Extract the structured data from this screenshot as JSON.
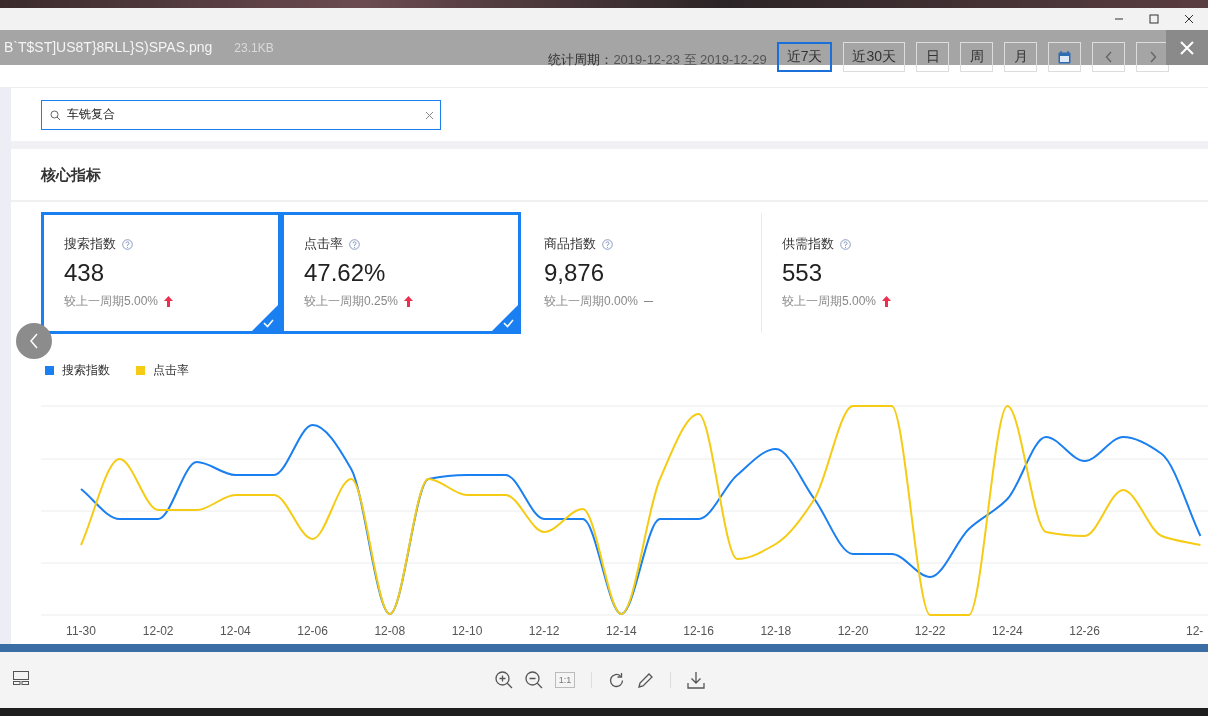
{
  "viewer": {
    "file_name": "B`T$ST]US8T}8RLL}S)SPAS.png",
    "file_size": "23.1KB"
  },
  "period": {
    "label": "统计周期：",
    "range": "2019-12-23 至 2019-12-29"
  },
  "range_buttons": [
    {
      "kind": "text",
      "label": "近7天",
      "selected": true
    },
    {
      "kind": "text",
      "label": "近30天",
      "selected": false
    },
    {
      "kind": "text",
      "label": "日",
      "selected": false
    },
    {
      "kind": "text",
      "label": "周",
      "selected": false
    },
    {
      "kind": "text",
      "label": "月",
      "selected": false
    },
    {
      "kind": "calendar",
      "selected": false
    },
    {
      "kind": "prev",
      "selected": false
    },
    {
      "kind": "next",
      "selected": false
    }
  ],
  "search": {
    "value": "车铣复合"
  },
  "section": {
    "title": "核心指标"
  },
  "metrics": [
    {
      "label": "搜索指数",
      "value": "438",
      "change": "较上一周期5.00%",
      "kind": "up",
      "selected": true
    },
    {
      "label": "点击率",
      "value": "47.62%",
      "change": "较上一周期0.25%",
      "kind": "up",
      "selected": true
    },
    {
      "label": "商品指数",
      "value": "9,876",
      "change": "较上一周期0.00%",
      "kind": "flat",
      "selected": false
    },
    {
      "label": "供需指数",
      "value": "553",
      "change": "较上一周期5.00%",
      "kind": "up",
      "selected": false
    }
  ],
  "chart": {
    "legend": [
      {
        "name": "搜索指数",
        "color": "#1a7ff0"
      },
      {
        "name": "点击率",
        "color": "#f5cb14"
      }
    ],
    "x_labels": [
      "11-30",
      "12-02",
      "12-04",
      "12-06",
      "12-08",
      "12-10",
      "12-12",
      "12-14",
      "12-16",
      "12-18",
      "12-20",
      "12-22",
      "12-24",
      "12-26",
      "12-"
    ]
  },
  "toolbar": {
    "actual_size": "1:1"
  }
}
